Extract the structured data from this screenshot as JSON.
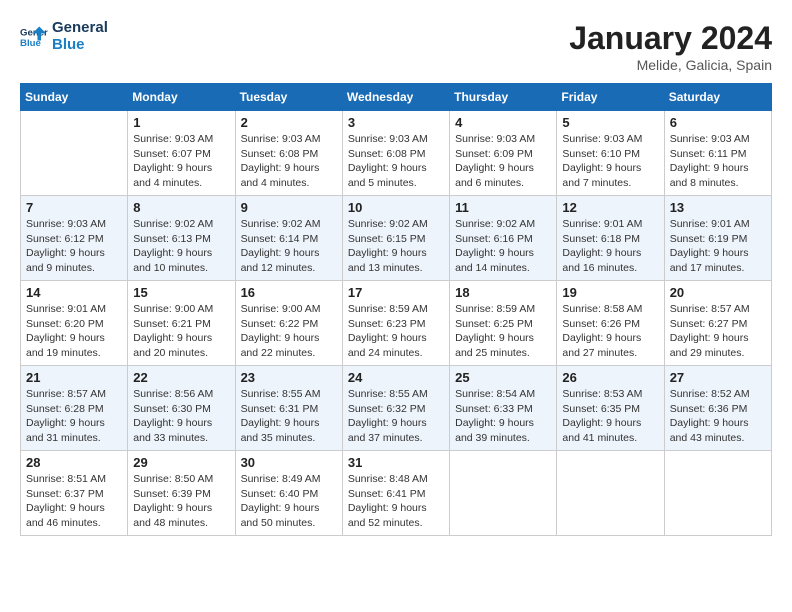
{
  "logo": {
    "line1": "General",
    "line2": "Blue"
  },
  "title": "January 2024",
  "location": "Melide, Galicia, Spain",
  "weekdays": [
    "Sunday",
    "Monday",
    "Tuesday",
    "Wednesday",
    "Thursday",
    "Friday",
    "Saturday"
  ],
  "weeks": [
    [
      {
        "day": "",
        "sunrise": "",
        "sunset": "",
        "daylight": ""
      },
      {
        "day": "1",
        "sunrise": "Sunrise: 9:03 AM",
        "sunset": "Sunset: 6:07 PM",
        "daylight": "Daylight: 9 hours and 4 minutes."
      },
      {
        "day": "2",
        "sunrise": "Sunrise: 9:03 AM",
        "sunset": "Sunset: 6:08 PM",
        "daylight": "Daylight: 9 hours and 4 minutes."
      },
      {
        "day": "3",
        "sunrise": "Sunrise: 9:03 AM",
        "sunset": "Sunset: 6:08 PM",
        "daylight": "Daylight: 9 hours and 5 minutes."
      },
      {
        "day": "4",
        "sunrise": "Sunrise: 9:03 AM",
        "sunset": "Sunset: 6:09 PM",
        "daylight": "Daylight: 9 hours and 6 minutes."
      },
      {
        "day": "5",
        "sunrise": "Sunrise: 9:03 AM",
        "sunset": "Sunset: 6:10 PM",
        "daylight": "Daylight: 9 hours and 7 minutes."
      },
      {
        "day": "6",
        "sunrise": "Sunrise: 9:03 AM",
        "sunset": "Sunset: 6:11 PM",
        "daylight": "Daylight: 9 hours and 8 minutes."
      }
    ],
    [
      {
        "day": "7",
        "sunrise": "Sunrise: 9:03 AM",
        "sunset": "Sunset: 6:12 PM",
        "daylight": "Daylight: 9 hours and 9 minutes."
      },
      {
        "day": "8",
        "sunrise": "Sunrise: 9:02 AM",
        "sunset": "Sunset: 6:13 PM",
        "daylight": "Daylight: 9 hours and 10 minutes."
      },
      {
        "day": "9",
        "sunrise": "Sunrise: 9:02 AM",
        "sunset": "Sunset: 6:14 PM",
        "daylight": "Daylight: 9 hours and 12 minutes."
      },
      {
        "day": "10",
        "sunrise": "Sunrise: 9:02 AM",
        "sunset": "Sunset: 6:15 PM",
        "daylight": "Daylight: 9 hours and 13 minutes."
      },
      {
        "day": "11",
        "sunrise": "Sunrise: 9:02 AM",
        "sunset": "Sunset: 6:16 PM",
        "daylight": "Daylight: 9 hours and 14 minutes."
      },
      {
        "day": "12",
        "sunrise": "Sunrise: 9:01 AM",
        "sunset": "Sunset: 6:18 PM",
        "daylight": "Daylight: 9 hours and 16 minutes."
      },
      {
        "day": "13",
        "sunrise": "Sunrise: 9:01 AM",
        "sunset": "Sunset: 6:19 PM",
        "daylight": "Daylight: 9 hours and 17 minutes."
      }
    ],
    [
      {
        "day": "14",
        "sunrise": "Sunrise: 9:01 AM",
        "sunset": "Sunset: 6:20 PM",
        "daylight": "Daylight: 9 hours and 19 minutes."
      },
      {
        "day": "15",
        "sunrise": "Sunrise: 9:00 AM",
        "sunset": "Sunset: 6:21 PM",
        "daylight": "Daylight: 9 hours and 20 minutes."
      },
      {
        "day": "16",
        "sunrise": "Sunrise: 9:00 AM",
        "sunset": "Sunset: 6:22 PM",
        "daylight": "Daylight: 9 hours and 22 minutes."
      },
      {
        "day": "17",
        "sunrise": "Sunrise: 8:59 AM",
        "sunset": "Sunset: 6:23 PM",
        "daylight": "Daylight: 9 hours and 24 minutes."
      },
      {
        "day": "18",
        "sunrise": "Sunrise: 8:59 AM",
        "sunset": "Sunset: 6:25 PM",
        "daylight": "Daylight: 9 hours and 25 minutes."
      },
      {
        "day": "19",
        "sunrise": "Sunrise: 8:58 AM",
        "sunset": "Sunset: 6:26 PM",
        "daylight": "Daylight: 9 hours and 27 minutes."
      },
      {
        "day": "20",
        "sunrise": "Sunrise: 8:57 AM",
        "sunset": "Sunset: 6:27 PM",
        "daylight": "Daylight: 9 hours and 29 minutes."
      }
    ],
    [
      {
        "day": "21",
        "sunrise": "Sunrise: 8:57 AM",
        "sunset": "Sunset: 6:28 PM",
        "daylight": "Daylight: 9 hours and 31 minutes."
      },
      {
        "day": "22",
        "sunrise": "Sunrise: 8:56 AM",
        "sunset": "Sunset: 6:30 PM",
        "daylight": "Daylight: 9 hours and 33 minutes."
      },
      {
        "day": "23",
        "sunrise": "Sunrise: 8:55 AM",
        "sunset": "Sunset: 6:31 PM",
        "daylight": "Daylight: 9 hours and 35 minutes."
      },
      {
        "day": "24",
        "sunrise": "Sunrise: 8:55 AM",
        "sunset": "Sunset: 6:32 PM",
        "daylight": "Daylight: 9 hours and 37 minutes."
      },
      {
        "day": "25",
        "sunrise": "Sunrise: 8:54 AM",
        "sunset": "Sunset: 6:33 PM",
        "daylight": "Daylight: 9 hours and 39 minutes."
      },
      {
        "day": "26",
        "sunrise": "Sunrise: 8:53 AM",
        "sunset": "Sunset: 6:35 PM",
        "daylight": "Daylight: 9 hours and 41 minutes."
      },
      {
        "day": "27",
        "sunrise": "Sunrise: 8:52 AM",
        "sunset": "Sunset: 6:36 PM",
        "daylight": "Daylight: 9 hours and 43 minutes."
      }
    ],
    [
      {
        "day": "28",
        "sunrise": "Sunrise: 8:51 AM",
        "sunset": "Sunset: 6:37 PM",
        "daylight": "Daylight: 9 hours and 46 minutes."
      },
      {
        "day": "29",
        "sunrise": "Sunrise: 8:50 AM",
        "sunset": "Sunset: 6:39 PM",
        "daylight": "Daylight: 9 hours and 48 minutes."
      },
      {
        "day": "30",
        "sunrise": "Sunrise: 8:49 AM",
        "sunset": "Sunset: 6:40 PM",
        "daylight": "Daylight: 9 hours and 50 minutes."
      },
      {
        "day": "31",
        "sunrise": "Sunrise: 8:48 AM",
        "sunset": "Sunset: 6:41 PM",
        "daylight": "Daylight: 9 hours and 52 minutes."
      },
      {
        "day": "",
        "sunrise": "",
        "sunset": "",
        "daylight": ""
      },
      {
        "day": "",
        "sunrise": "",
        "sunset": "",
        "daylight": ""
      },
      {
        "day": "",
        "sunrise": "",
        "sunset": "",
        "daylight": ""
      }
    ]
  ]
}
